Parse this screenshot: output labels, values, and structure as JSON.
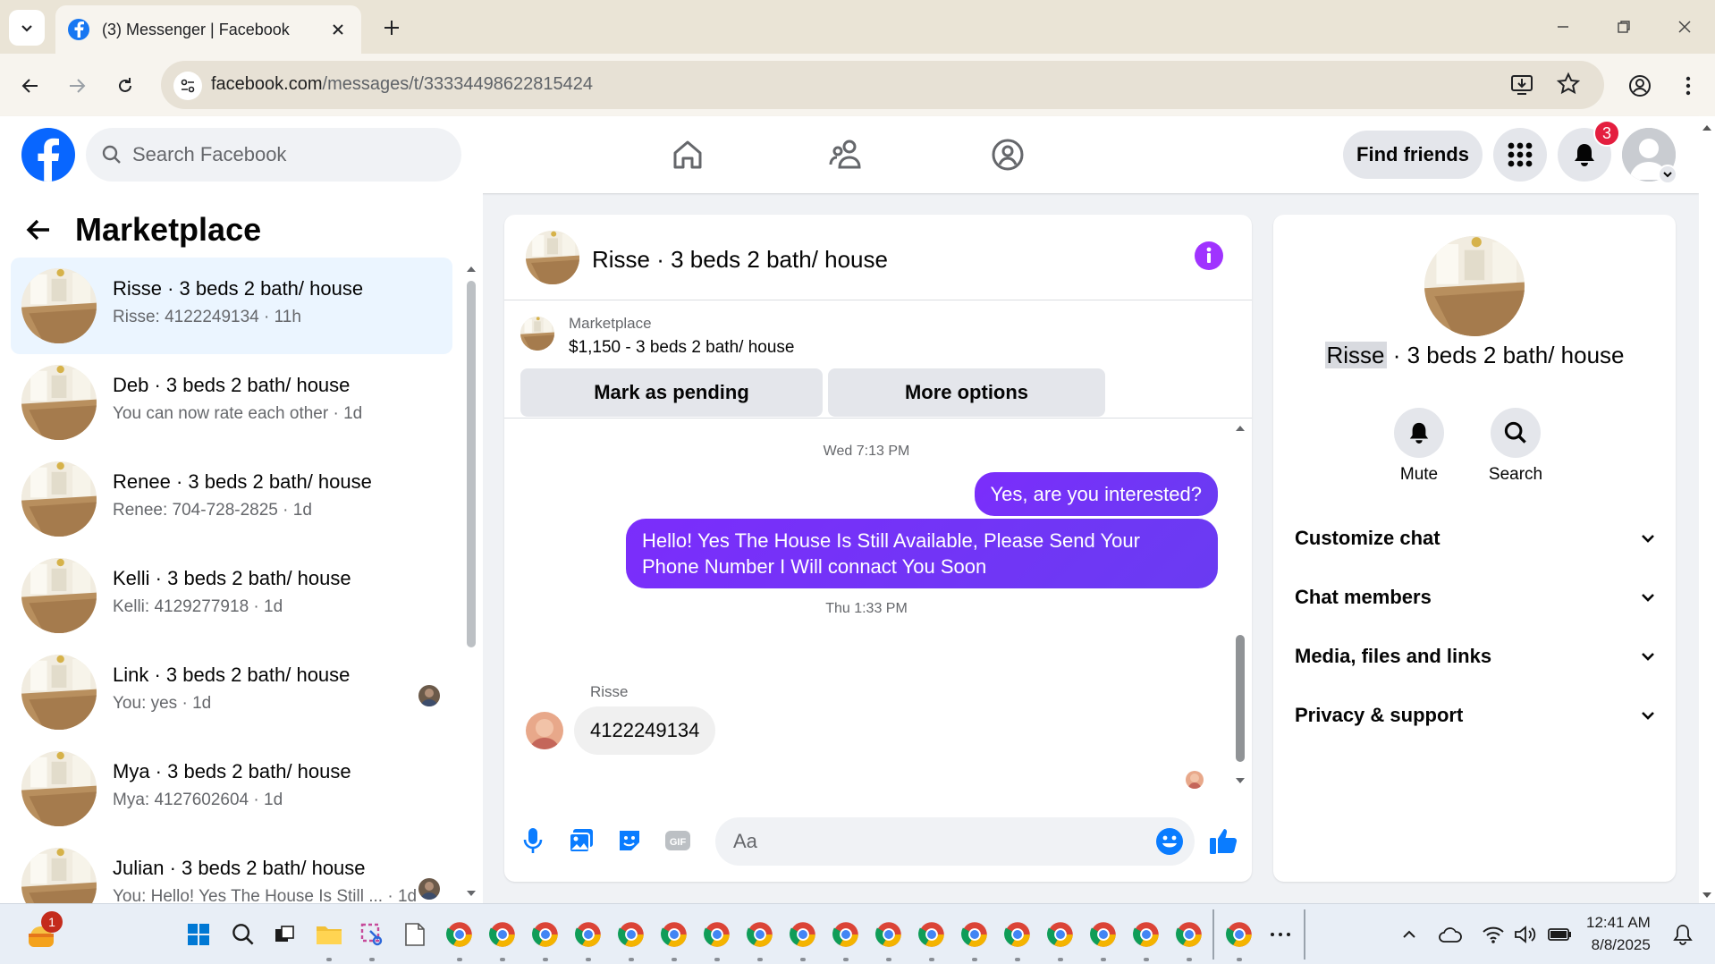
{
  "browser": {
    "tab_title": "(3) Messenger | Facebook",
    "url_host": "facebook.com",
    "url_path": "/messages/t/33334498622815424"
  },
  "fb_header": {
    "search_placeholder": "Search Facebook",
    "find_friends_label": "Find friends",
    "notifications_count": "3",
    "brand_color": "#0866ff"
  },
  "left_panel": {
    "title": "Marketplace",
    "conversations": [
      {
        "name": "Risse · 3 beds 2 bath/ house",
        "preview": "Risse: 4122249134 · 11h",
        "active": true
      },
      {
        "name": "Deb · 3 beds 2 bath/ house",
        "preview": "You can now rate each other · 1d"
      },
      {
        "name": "Renee · 3 beds 2 bath/ house",
        "preview": "Renee: 704-728-2825 · 1d"
      },
      {
        "name": "Kelli · 3 beds 2 bath/ house",
        "preview": "Kelli: 4129277918 · 1d"
      },
      {
        "name": "Link · 3 beds 2 bath/ house",
        "preview": "You: yes · 1d",
        "seen": true
      },
      {
        "name": "Mya · 3 beds 2 bath/ house",
        "preview": "Mya: 4127602604 · 1d"
      },
      {
        "name": "Julian · 3 beds 2 bath/ house",
        "preview": "You: Hello! Yes The House Is Still ... · 1d",
        "seen": true
      }
    ]
  },
  "chat": {
    "title": "Risse · 3 beds 2 bath/ house",
    "listing_label": "Marketplace",
    "listing_price": "$1,150 - 3 beds 2 bath/ house",
    "mark_pending_label": "Mark as pending",
    "more_options_label": "More options",
    "stamp_1": "Wed 7:13 PM",
    "out_msg_1": "Yes, are you interested?",
    "out_msg_2": "Hello! Yes The House  Is Still Available, Please Send Your Phone Number I Will connact You Soon",
    "stamp_2": "Thu 1:33 PM",
    "in_sender": "Risse",
    "in_msg": "4122249134",
    "composer_placeholder": "Aa",
    "accent_color": "#7b2ffc"
  },
  "right_panel": {
    "title_name": "Risse",
    "title_rest": " · 3 beds 2 bath/ house",
    "mute_label": "Mute",
    "search_label": "Search",
    "sections": [
      "Customize chat",
      "Chat members",
      "Media, files and links",
      "Privacy & support"
    ]
  },
  "taskbar": {
    "time": "12:41 AM",
    "date": "8/8/2025",
    "widget_badge": "1"
  }
}
